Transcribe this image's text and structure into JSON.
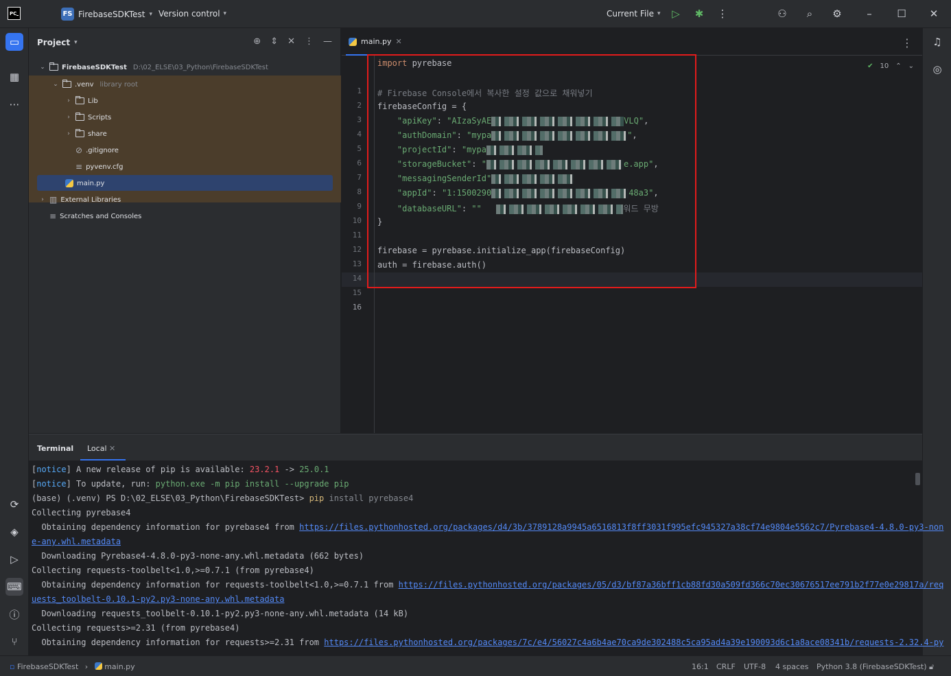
{
  "titlebar": {
    "logo": "PC",
    "project_badge": "FS",
    "project_name": "FirebaseSDKTest",
    "version_control": "Version control",
    "run_config": "Current File"
  },
  "project_panel": {
    "title": "Project",
    "root": {
      "name": "FirebaseSDKTest",
      "path": "D:\\02_ELSE\\03_Python\\FirebaseSDKTest"
    },
    "venv": {
      "name": ".venv",
      "note": "library root"
    },
    "items": [
      "Lib",
      "Scripts",
      "share",
      ".gitignore",
      "pyvenv.cfg"
    ],
    "main_file": "main.py",
    "external": "External Libraries",
    "scratches": "Scratches and Consoles"
  },
  "editor": {
    "tab": "main.py",
    "inspection_count": "10",
    "line_numbers": [
      "1",
      "2",
      "3",
      "4",
      "5",
      "6",
      "7",
      "8",
      "9",
      "10",
      "11",
      "12",
      "13",
      "14",
      "15",
      "16"
    ],
    "code": {
      "l1_kw": "import",
      "l1_rest": " pyrebase",
      "l3": "# Firebase Console에서 복사한 설정 값으로 채워넣기",
      "l4": "firebaseConfig = {",
      "l5_key": "\"apiKey\"",
      "l5_val_a": "\"AIzaSyAE",
      "l5_val_b": "VLQ\"",
      "l6_key": "\"authDomain\"",
      "l6_val_a": "\"mypa",
      "l6_val_b": "\"",
      "l7_key": "\"projectId\"",
      "l7_val_a": "\"mypa",
      "l8_key": "\"storageBucket\"",
      "l8_val_a": "\"",
      "l8_val_b": "e.app\"",
      "l9_key": "\"messagingSenderId\"",
      "l10_key": "\"appId\"",
      "l10_val_a": "\"1:1500290",
      "l10_val_b": "48a3\"",
      "l11_key": "\"databaseURL\"",
      "l11_val_a": "\"\"",
      "l11_tail": "워드 무방",
      "l12": "}",
      "l14": "firebase = pyrebase.initialize_app(firebaseConfig)",
      "l15": "auth = firebase.auth()"
    }
  },
  "terminal": {
    "tab_title": "Terminal",
    "tab_local": "Local",
    "l1_tag": "notice",
    "l1_text": " A new release of pip is available: ",
    "l1_old": "23.2.1",
    "l1_arrow": " -> ",
    "l1_new": "25.0.1",
    "l2_tag": "notice",
    "l2_text": " To update, run: ",
    "l2_cmd": "python.exe -m pip install --upgrade pip",
    "l3_prompt": "(base) (.venv) PS D:\\02_ELSE\\03_Python\\FirebaseSDKTest> ",
    "l3_pip": "pip",
    "l3_rest": " install pyrebase4",
    "l4": "Collecting pyrebase4",
    "l5_text": "  Obtaining dependency information for pyrebase4 from ",
    "l5_url": "https://files.pythonhosted.org/packages/d4/3b/3789128a9945a6516813f8ff3031f995efc945327a38cf74e9804e5562c7/Pyrebase4-4.8.0-py3-non",
    "l6_url": "e-any.whl.metadata",
    "l7": "  Downloading Pyrebase4-4.8.0-py3-none-any.whl.metadata (662 bytes)",
    "l8": "Collecting requests-toolbelt<1.0,>=0.7.1 (from pyrebase4)",
    "l9_text": "  Obtaining dependency information for requests-toolbelt<1.0,>=0.7.1 from ",
    "l9_url": "https://files.pythonhosted.org/packages/05/d3/bf87a36bff1cb88fd30a509fd366c70ec30676517ee791b2f77e0e29817a/req",
    "l10_url": "uests_toolbelt-0.10.1-py2.py3-none-any.whl.metadata",
    "l11": "  Downloading requests_toolbelt-0.10.1-py2.py3-none-any.whl.metadata (14 kB)",
    "l12": "Collecting requests>=2.31 (from pyrebase4)",
    "l13_text": "  Obtaining dependency information for requests>=2.31 from ",
    "l13_url": "https://files.pythonhosted.org/packages/7c/e4/56027c4a6b4ae70ca9de302488c5ca95ad4a39e190093d6c1a8ace08341b/requests-2.32.4-py"
  },
  "statusbar": {
    "project": "FirebaseSDKTest",
    "file": "main.py",
    "position": "16:1",
    "line_sep": "CRLF",
    "encoding": "UTF-8",
    "indent": "4 spaces",
    "interpreter": "Python 3.8 (FirebaseSDKTest)"
  },
  "colors": {
    "accent": "#3574f0",
    "highlight_box": "#e41b1b",
    "venv_bg": "#4b3d2b"
  }
}
